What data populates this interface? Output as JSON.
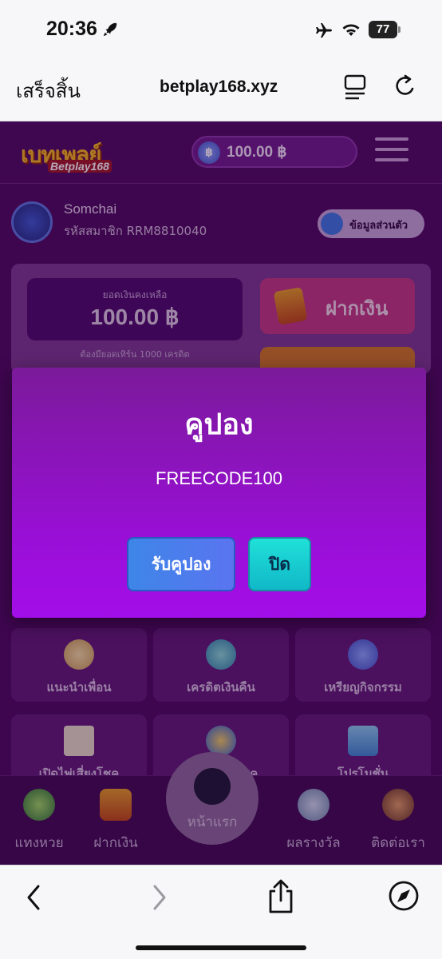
{
  "status_bar": {
    "time": "20:36",
    "battery": "77"
  },
  "browser": {
    "done_label": "เสร็จสิ้น",
    "url": "betplay168.xyz"
  },
  "site": {
    "logo_main": "เบทเพลย์",
    "logo_sub": "Betplay168",
    "balance": "100.00 ฿",
    "user_name": "Somchai",
    "member_id": "รหัสสมาชิก RRM8810040",
    "profile_label": "ข้อมูลส่วนตัว",
    "wallet": {
      "label": "ยอดเงินคงเหลือ",
      "amount": "100.00 ฿",
      "note": "ต้องมียอดเทิร์น 1000 เครดิต",
      "deposit_label": "ฝากเงิน"
    },
    "tiles": [
      {
        "label": "แนะนำเพื่อน",
        "icon": "coins-icon"
      },
      {
        "label": "เครดิตเงินคืน",
        "icon": "money-bag-icon"
      },
      {
        "label": "เหรียญกิจกรรม",
        "icon": "coin-icon"
      },
      {
        "label": "เปิดไพ่เสี่ยงโชค",
        "icon": "cards-icon"
      },
      {
        "label": "วงล้อเสี่ยงโชค",
        "icon": "wheel-icon"
      },
      {
        "label": "โปรโมชั่น",
        "icon": "gift-icon"
      }
    ],
    "bottom_nav": [
      {
        "label": "แทงหวย",
        "icon": "lottery-balls-icon"
      },
      {
        "label": "ฝากเงิน",
        "icon": "deposit-icon"
      },
      {
        "label": "หน้าแรก",
        "icon": "home-icon"
      },
      {
        "label": "ผลรางวัล",
        "icon": "medal-icon"
      },
      {
        "label": "ติดต่อเรา",
        "icon": "contact-icon"
      }
    ]
  },
  "modal": {
    "title": "คูปอง",
    "code": "FREECODE100",
    "claim_label": "รับคูปอง",
    "close_label": "ปิด"
  }
}
